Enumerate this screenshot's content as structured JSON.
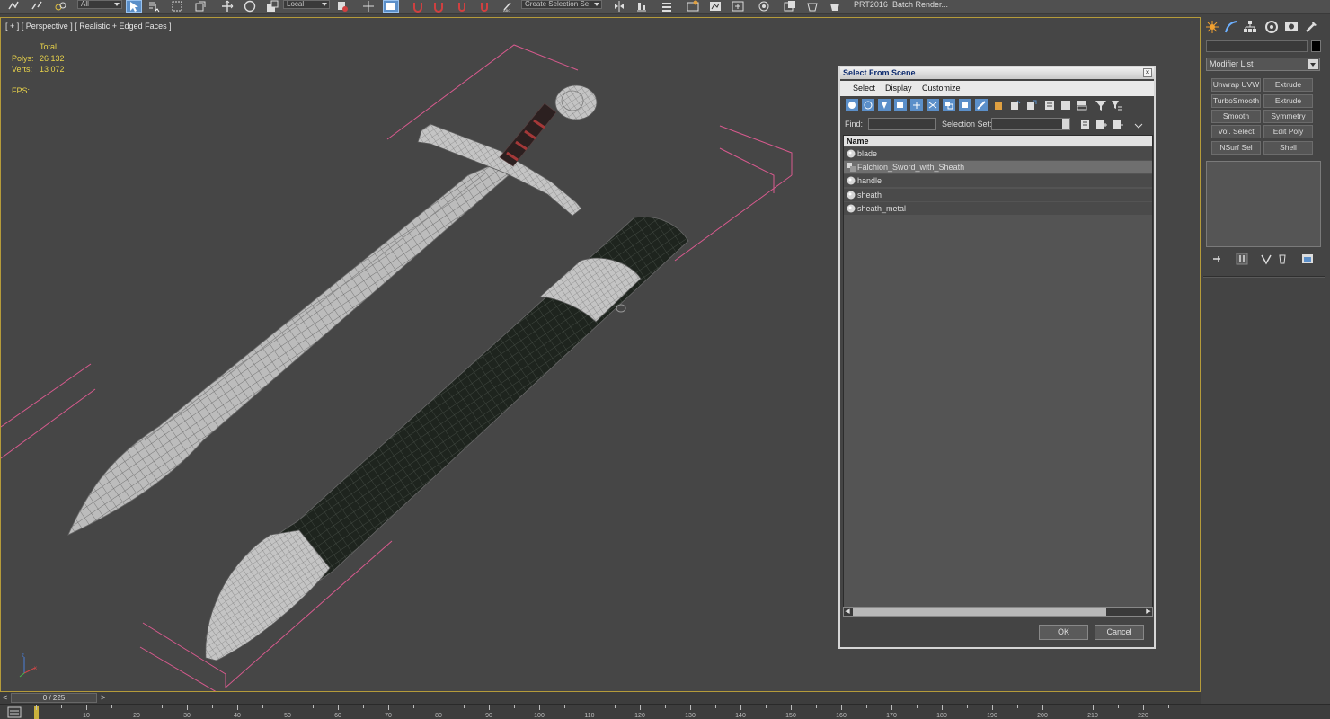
{
  "toolbar": {
    "selection_filter": "All",
    "ref_coord": "Local",
    "named_selection_placeholder": "Create Selection Se",
    "prt_label": "PRT2016",
    "batch_render_label": "Batch Render..."
  },
  "viewport": {
    "label": "[ + ] [ Perspective ] [ Realistic + Edged Faces ]",
    "stats": {
      "header": "Total",
      "polys_label": "Polys:",
      "polys_value": "26 132",
      "verts_label": "Verts:",
      "verts_value": "13 072",
      "fps_label": "FPS:"
    }
  },
  "dialog": {
    "title": "Select From Scene",
    "close": "×",
    "menu": [
      "Select",
      "Display",
      "Customize"
    ],
    "find_label": "Find:",
    "selection_set_label": "Selection Set:",
    "column_name": "Name",
    "items": [
      {
        "name": "blade",
        "type": "object"
      },
      {
        "name": "Falchion_Sword_with_Sheath",
        "type": "group"
      },
      {
        "name": "handle",
        "type": "object"
      },
      {
        "name": "sheath",
        "type": "object"
      },
      {
        "name": "sheath_metal",
        "type": "object"
      }
    ],
    "ok_label": "OK",
    "cancel_label": "Cancel"
  },
  "command_panel": {
    "modifier_list_label": "Modifier List",
    "modifier_buttons": [
      [
        "Unwrap UVW",
        "Extrude"
      ],
      [
        "TurboSmooth",
        "Extrude"
      ],
      [
        "Smooth",
        "Symmetry"
      ],
      [
        "Vol. Select",
        "Edit Poly"
      ],
      [
        "NSurf Sel",
        "Shell"
      ]
    ]
  },
  "timeline": {
    "frame_display": "0 / 225",
    "prev_arrow": "<",
    "next_arrow": ">",
    "ruler_labels": [
      "10",
      "20",
      "30",
      "40",
      "50",
      "60",
      "70",
      "80",
      "90",
      "100",
      "110",
      "120",
      "130",
      "140",
      "150",
      "160",
      "170",
      "180",
      "190",
      "200",
      "210",
      "220"
    ]
  },
  "colors": {
    "stats_yellow": "#e8d24a",
    "viewport_border": "#b59b3a",
    "bbox_pink": "#d85a8e",
    "active_tool": "#5b8fc9"
  }
}
